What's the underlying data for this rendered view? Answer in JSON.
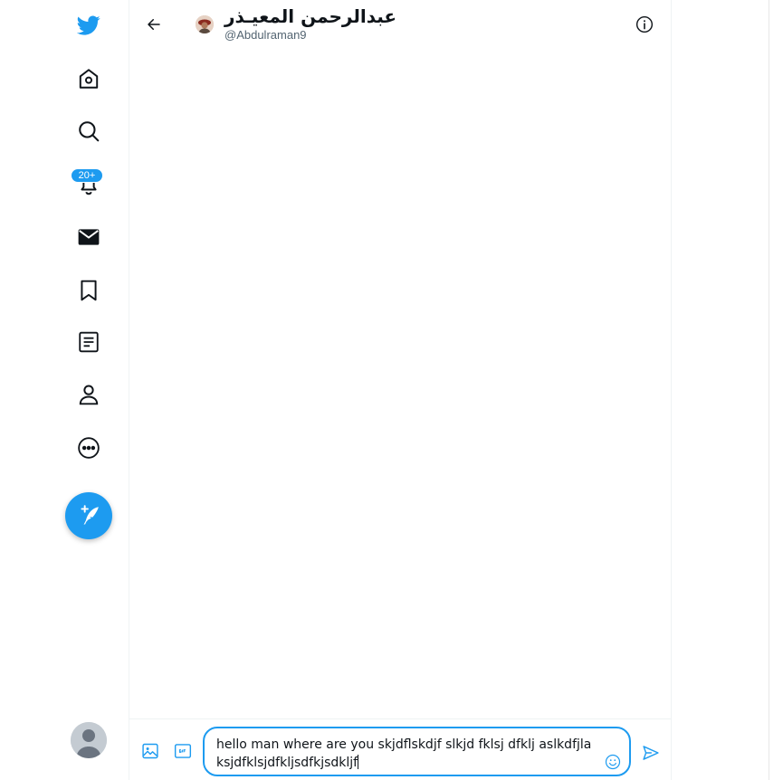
{
  "colors": {
    "accent": "#1d9bf0",
    "text": "#0f1419",
    "secondary": "#536471"
  },
  "nav": {
    "items": [
      {
        "icon": "twitter-logo-icon"
      },
      {
        "icon": "home-icon"
      },
      {
        "icon": "explore-icon"
      },
      {
        "icon": "notifications-icon",
        "badge": "20+"
      },
      {
        "icon": "messages-icon"
      },
      {
        "icon": "bookmark-icon"
      },
      {
        "icon": "lists-icon"
      },
      {
        "icon": "profile-icon"
      },
      {
        "icon": "more-icon"
      }
    ],
    "compose_icon": "compose-tweet-icon"
  },
  "conversation": {
    "name": "عبدالرحمن المعيـذر",
    "handle": "@Abdulraman9"
  },
  "composer": {
    "message": "hello man where are you skjdflskdjf slkjd fklsj dfklj aslkdfjlaksjdfklsjdfkljsdfkjsdkljf"
  }
}
